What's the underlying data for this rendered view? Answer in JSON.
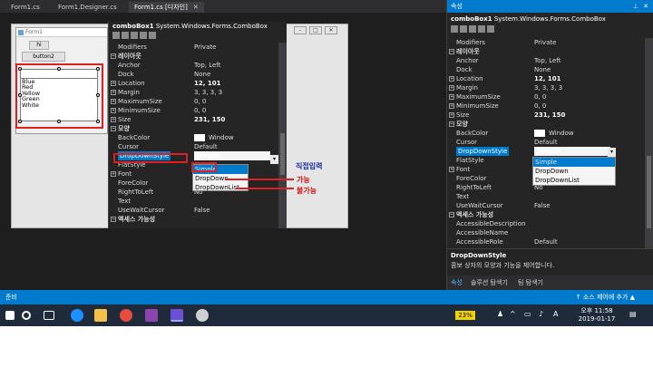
{
  "tabs": [
    {
      "label": "Form1.cs",
      "active": false
    },
    {
      "label": "Form1.Designer.cs",
      "active": false
    },
    {
      "label": "Form1.cs [디자인]",
      "active": true
    }
  ],
  "form": {
    "title": "Form1",
    "button1": "hi",
    "button2": "button2",
    "combo_items": [
      "Blue",
      "Red",
      "Yellow",
      "Green",
      "White"
    ]
  },
  "inner_grid": {
    "object_name": "comboBox1",
    "object_type": "System.Windows.Forms.ComboBox",
    "rows": [
      {
        "kind": "prop",
        "name": "Modifiers",
        "value": "Private"
      },
      {
        "kind": "cat",
        "name": "레이아웃"
      },
      {
        "kind": "prop",
        "name": "Anchor",
        "value": "Top, Left"
      },
      {
        "kind": "prop",
        "name": "Dock",
        "value": "None"
      },
      {
        "kind": "prop",
        "name": "Location",
        "value": "12, 101",
        "bold": true,
        "expand": true
      },
      {
        "kind": "prop",
        "name": "Margin",
        "value": "3, 3, 3, 3",
        "expand": true
      },
      {
        "kind": "prop",
        "name": "MaximumSize",
        "value": "0, 0",
        "expand": true
      },
      {
        "kind": "prop",
        "name": "MinimumSize",
        "value": "0, 0",
        "expand": true
      },
      {
        "kind": "prop",
        "name": "Size",
        "value": "231, 150",
        "bold": true,
        "expand": true
      },
      {
        "kind": "cat",
        "name": "모양"
      },
      {
        "kind": "prop",
        "name": "BackColor",
        "value": "Window",
        "swatch": true
      },
      {
        "kind": "prop",
        "name": "Cursor",
        "value": "Default"
      },
      {
        "kind": "prop",
        "name": "DropDownStyle",
        "value": "Simple",
        "bold": true,
        "selected": true
      },
      {
        "kind": "prop",
        "name": "FlatStyle",
        "value": ""
      },
      {
        "kind": "prop",
        "name": "Font",
        "value": "",
        "expand": true
      },
      {
        "kind": "prop",
        "name": "ForeColor",
        "value": ""
      },
      {
        "kind": "prop",
        "name": "RightToLeft",
        "value": "No"
      },
      {
        "kind": "prop",
        "name": "Text",
        "value": ""
      },
      {
        "kind": "prop",
        "name": "UseWaitCursor",
        "value": "False"
      },
      {
        "kind": "cat",
        "name": "액세스 가능성"
      }
    ],
    "dropdown_options": [
      "Simple",
      "DropDown",
      "DropDownList"
    ]
  },
  "annotations": {
    "direct_input": "직접입력",
    "possible": "가능",
    "impossible": "불가능"
  },
  "right_pane": {
    "header": "속성",
    "object_name": "comboBox1",
    "object_type": "System.Windows.Forms.ComboBox",
    "rows": [
      {
        "kind": "prop",
        "name": "Modifiers",
        "value": "Private"
      },
      {
        "kind": "cat",
        "name": "레이아웃"
      },
      {
        "kind": "prop",
        "name": "Anchor",
        "value": "Top, Left"
      },
      {
        "kind": "prop",
        "name": "Dock",
        "value": "None"
      },
      {
        "kind": "prop",
        "name": "Location",
        "value": "12, 101",
        "bold": true,
        "expand": true
      },
      {
        "kind": "prop",
        "name": "Margin",
        "value": "3, 3, 3, 3",
        "expand": true
      },
      {
        "kind": "prop",
        "name": "MaximumSize",
        "value": "0, 0",
        "expand": true
      },
      {
        "kind": "prop",
        "name": "MinimumSize",
        "value": "0, 0",
        "expand": true
      },
      {
        "kind": "prop",
        "name": "Size",
        "value": "231, 150",
        "bold": true,
        "expand": true
      },
      {
        "kind": "cat",
        "name": "모양"
      },
      {
        "kind": "prop",
        "name": "BackColor",
        "value": "Window",
        "swatch": true
      },
      {
        "kind": "prop",
        "name": "Cursor",
        "value": "Default"
      },
      {
        "kind": "prop",
        "name": "DropDownStyle",
        "value": "Simple",
        "bold": true,
        "selected": true
      },
      {
        "kind": "prop",
        "name": "FlatStyle",
        "value": ""
      },
      {
        "kind": "prop",
        "name": "Font",
        "value": "",
        "expand": true
      },
      {
        "kind": "prop",
        "name": "ForeColor",
        "value": ""
      },
      {
        "kind": "prop",
        "name": "RightToLeft",
        "value": "No"
      },
      {
        "kind": "prop",
        "name": "Text",
        "value": ""
      },
      {
        "kind": "prop",
        "name": "UseWaitCursor",
        "value": "False"
      },
      {
        "kind": "cat",
        "name": "액세스 가능성"
      },
      {
        "kind": "prop",
        "name": "AccessibleDescription",
        "value": ""
      },
      {
        "kind": "prop",
        "name": "AccessibleName",
        "value": ""
      },
      {
        "kind": "prop",
        "name": "AccessibleRole",
        "value": "Default"
      }
    ],
    "dropdown_options": [
      "Simple",
      "DropDown",
      "DropDownList"
    ],
    "desc_title": "DropDownStyle",
    "desc_text": "콤보 상자의 모양과 기능을 제어합니다.",
    "bottom_tabs": [
      "속성",
      "솔루션 탐색기",
      "팀 탐색기"
    ]
  },
  "status": {
    "left": "준비",
    "right": "↑ 소스 제어에 추가 ▲"
  },
  "taskbar": {
    "battery": "23%",
    "time": "오후 11:58",
    "date": "2019-01-17"
  },
  "colors": {
    "accent": "#007acc",
    "ide_bg": "#2d2d30",
    "annotation_red": "#e02020"
  }
}
